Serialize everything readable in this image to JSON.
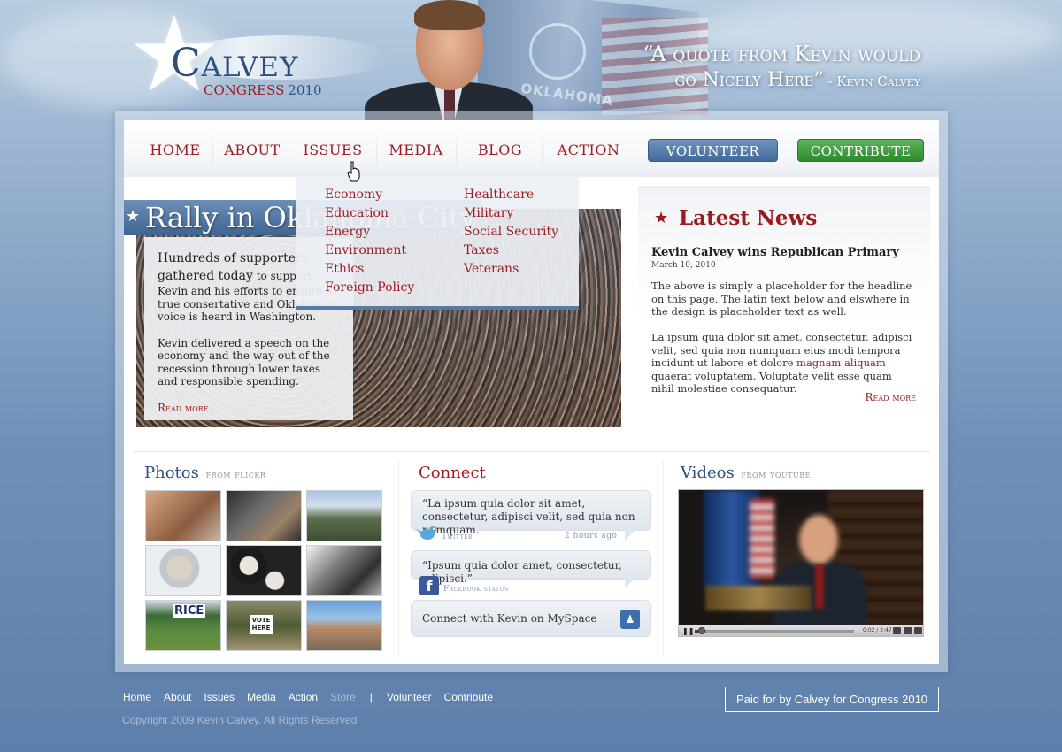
{
  "header": {
    "logo_name": "Calvey",
    "logo_congress": "CONGRESS",
    "logo_year": "2010",
    "flag_text": "OKLAHOMA",
    "quote_line1": "“A quote from Kevin would",
    "quote_line2": "go Nicely Here”",
    "quote_attribution": " - Kevin Calvey"
  },
  "nav": {
    "items": [
      "HOME",
      "ABOUT",
      "ISSUES",
      "MEDIA",
      "BLOG",
      "ACTION"
    ],
    "volunteer_label": "VOLUNTEER",
    "contribute_label": "CONTRIBUTE"
  },
  "issues_menu": {
    "column1": [
      "Economy",
      "Education",
      "Energy",
      "Environment",
      "Ethics",
      "Foreign Policy"
    ],
    "column2": [
      "Healthcare",
      "Military",
      "Social Security",
      "Taxes",
      "Veterans"
    ]
  },
  "hero": {
    "title": "Rally in Oklahoma City",
    "lead": "Hundreds of supporters gathered today",
    "lead_rest": " to support Kevin and his efforts to ensure a true consertative and Oklahoman voice is heard in Washington.",
    "body": "Kevin delivered a speech on the economy and the way out of the recession through lower taxes and responsible spending.",
    "read_more": "Read more"
  },
  "news": {
    "title": "Latest News",
    "headline": "Kevin Calvey wins Republican Primary",
    "date": "March 10, 2010",
    "paragraph1": "The above is simply a placeholder for the headline on this page. The latin text below and elswhere in the design is placeholder text as well.",
    "paragraph2_a": "La ipsum quia dolor sit amet, consectetur, adipisci velit, sed quia non numquam eius modi tempora incidunt ut labore et dolore ",
    "paragraph2_link": "magnam aliquam",
    "paragraph2_b": " quaerat voluptatem. Voluptate velit esse quam nihil molestiae consequatur.",
    "read_more": "Read more"
  },
  "photos": {
    "title": "Photos",
    "subtitle": "from flickr",
    "sign_rice": "RICE",
    "sign_vote": "VOTE HERE"
  },
  "connect": {
    "title": "Connect",
    "tweet_text": "“La ipsum quia dolor sit amet, consectetur, adipisci velit, sed quia non numquam.",
    "tweet_source": "Twitter",
    "tweet_time": "2 hours ago",
    "facebook_text": "“Ipsum quia dolor amet, consectetur, adipisci.”",
    "facebook_source": "Facebook status",
    "myspace_text": "Connect with Kevin on MySpace"
  },
  "videos": {
    "title": "Videos",
    "subtitle": "from youtube",
    "time": "0:02 / 2:47",
    "progress": 0.02
  },
  "footer": {
    "links": [
      "Home",
      "About",
      "Issues",
      "Media",
      "Action"
    ],
    "store": "Store",
    "separator": "|",
    "links2": [
      "Volunteer",
      "Contribute"
    ],
    "copyright": "Copyright 2009 Kevin Calvey. All Rights Reserved",
    "paid_for": "Paid for by Calvey for Congress 2010"
  },
  "colors": {
    "brand_red": "#9b1b1f",
    "brand_blue": "#2d4f7c",
    "volunteer_blue": "#426a99",
    "contribute_green": "#2f8a2f"
  }
}
